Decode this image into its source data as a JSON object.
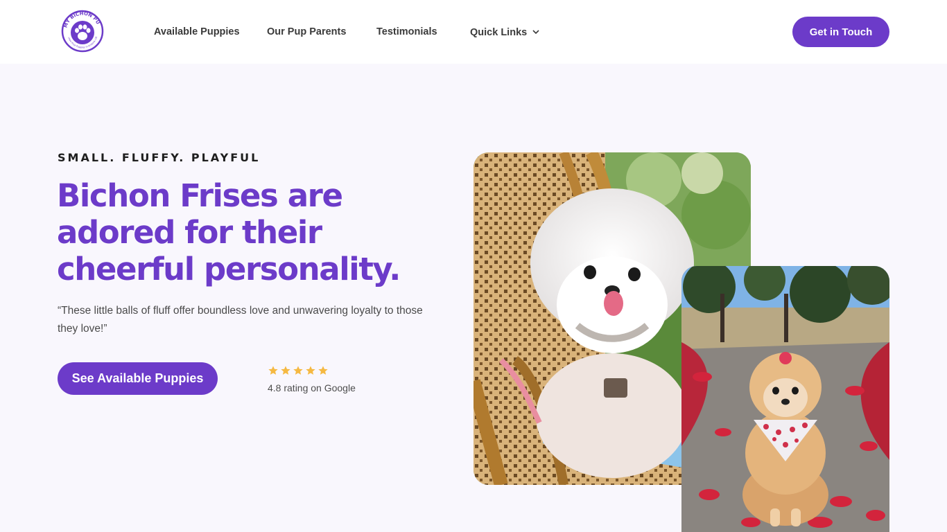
{
  "header": {
    "logo": {
      "brand_text": "MY BICHON PUP",
      "tagline": "Bichon Frise Puppies in Arizona, USA",
      "icon": "paw-icon",
      "color": "#6c3bc9"
    },
    "nav": [
      {
        "label": "Available Puppies"
      },
      {
        "label": "Our Pup Parents"
      },
      {
        "label": "Testimonials"
      },
      {
        "label": "Quick Links",
        "icon": "chevron-down-icon"
      }
    ],
    "cta_label": "Get in Touch"
  },
  "hero": {
    "eyebrow": "SMALL. FLUFFY. PLAYFUL",
    "headline": "Bichon Frises are adored for their cheerful personality.",
    "quote": "“These little balls of fluff offer boundless love and unwavering loyalty to those they love!”",
    "button_label": "See Available Puppies",
    "rating": {
      "stars": 5,
      "star_color": "#f5b942",
      "text": "4.8 rating on Google"
    }
  },
  "photos": [
    {
      "name": "bichon-on-chair-photo"
    },
    {
      "name": "pomeranian-on-leaves-photo"
    }
  ],
  "colors": {
    "accent": "#6c3bc9",
    "background": "#f9f7fd",
    "header_bg": "#ffffff"
  }
}
